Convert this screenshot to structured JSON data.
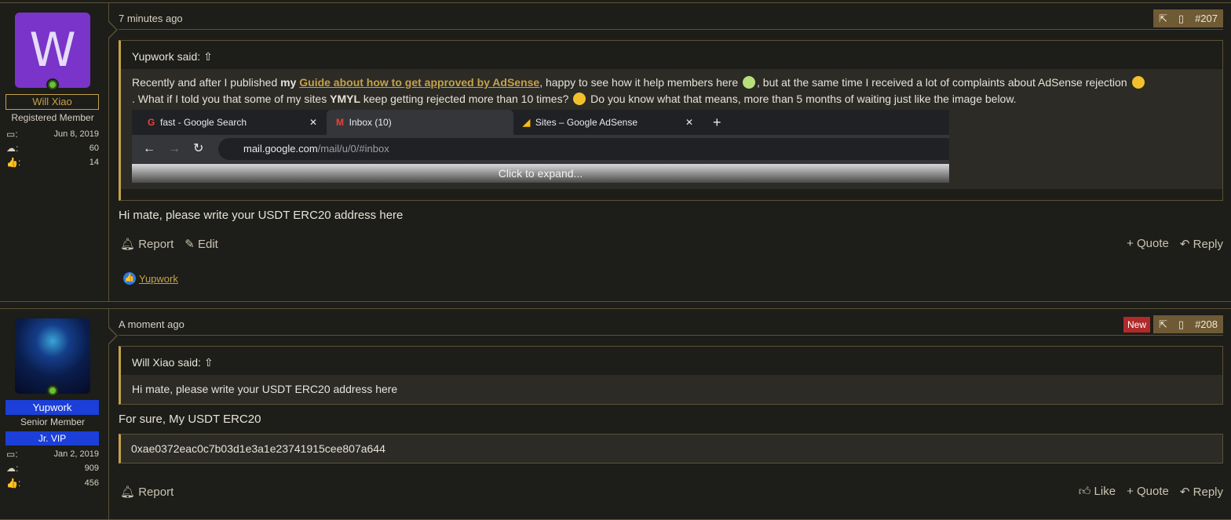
{
  "posts": [
    {
      "user": {
        "name": "Will Xiao",
        "avatar_letter": "W",
        "title": "Registered Member",
        "joined": "Jun 8, 2019",
        "messages": "60",
        "reactions": "14"
      },
      "date": "7 minutes ago",
      "post_number": "#207",
      "quote": {
        "author": "Yupwork said:",
        "text_1": "Recently and after I published ",
        "bold_my": "my",
        "link": "Guide about how to get approved by AdSense",
        "text_2": ", happy to see how it help members here",
        "text_3": ", but at the same time I received a lot of complaints about AdSense rejection",
        "text_4": ". What if I told you that some of my sites ",
        "bold_ymyl": "YMYL",
        "text_5": " keep getting rejected more than 10 times?",
        "text_6": " Do you know what that means, more than 5 months of waiting just like the image below.",
        "browser": {
          "tabs": [
            "fast - Google Search",
            "Inbox (10)",
            "Sites – Google AdSense"
          ],
          "url_main": "mail.google.com",
          "url_path": "/mail/u/0/#inbox"
        },
        "expand": "Click to expand..."
      },
      "body": "Hi mate, please write your USDT ERC20 address here",
      "footer": {
        "report": "Report",
        "edit": "Edit",
        "quote": "Quote",
        "reply": "Reply"
      },
      "reaction_user": "Yupwork"
    },
    {
      "user": {
        "name": "Yupwork",
        "title": "Senior Member",
        "badge": "Jr. VIP",
        "joined": "Jan 2, 2019",
        "messages": "909",
        "reactions": "456"
      },
      "date": "A moment ago",
      "new_label": "New",
      "post_number": "#208",
      "quote": {
        "author": "Will Xiao said:",
        "text": "Hi mate, please write your USDT ERC20 address here"
      },
      "body": "For sure, My USDT ERC20",
      "code": "0xae0372eac0c7b03d1e3a1e23741915cee807a644",
      "footer": {
        "report": "Report",
        "like": "Like",
        "quote": "Quote",
        "reply": "Reply"
      }
    }
  ]
}
